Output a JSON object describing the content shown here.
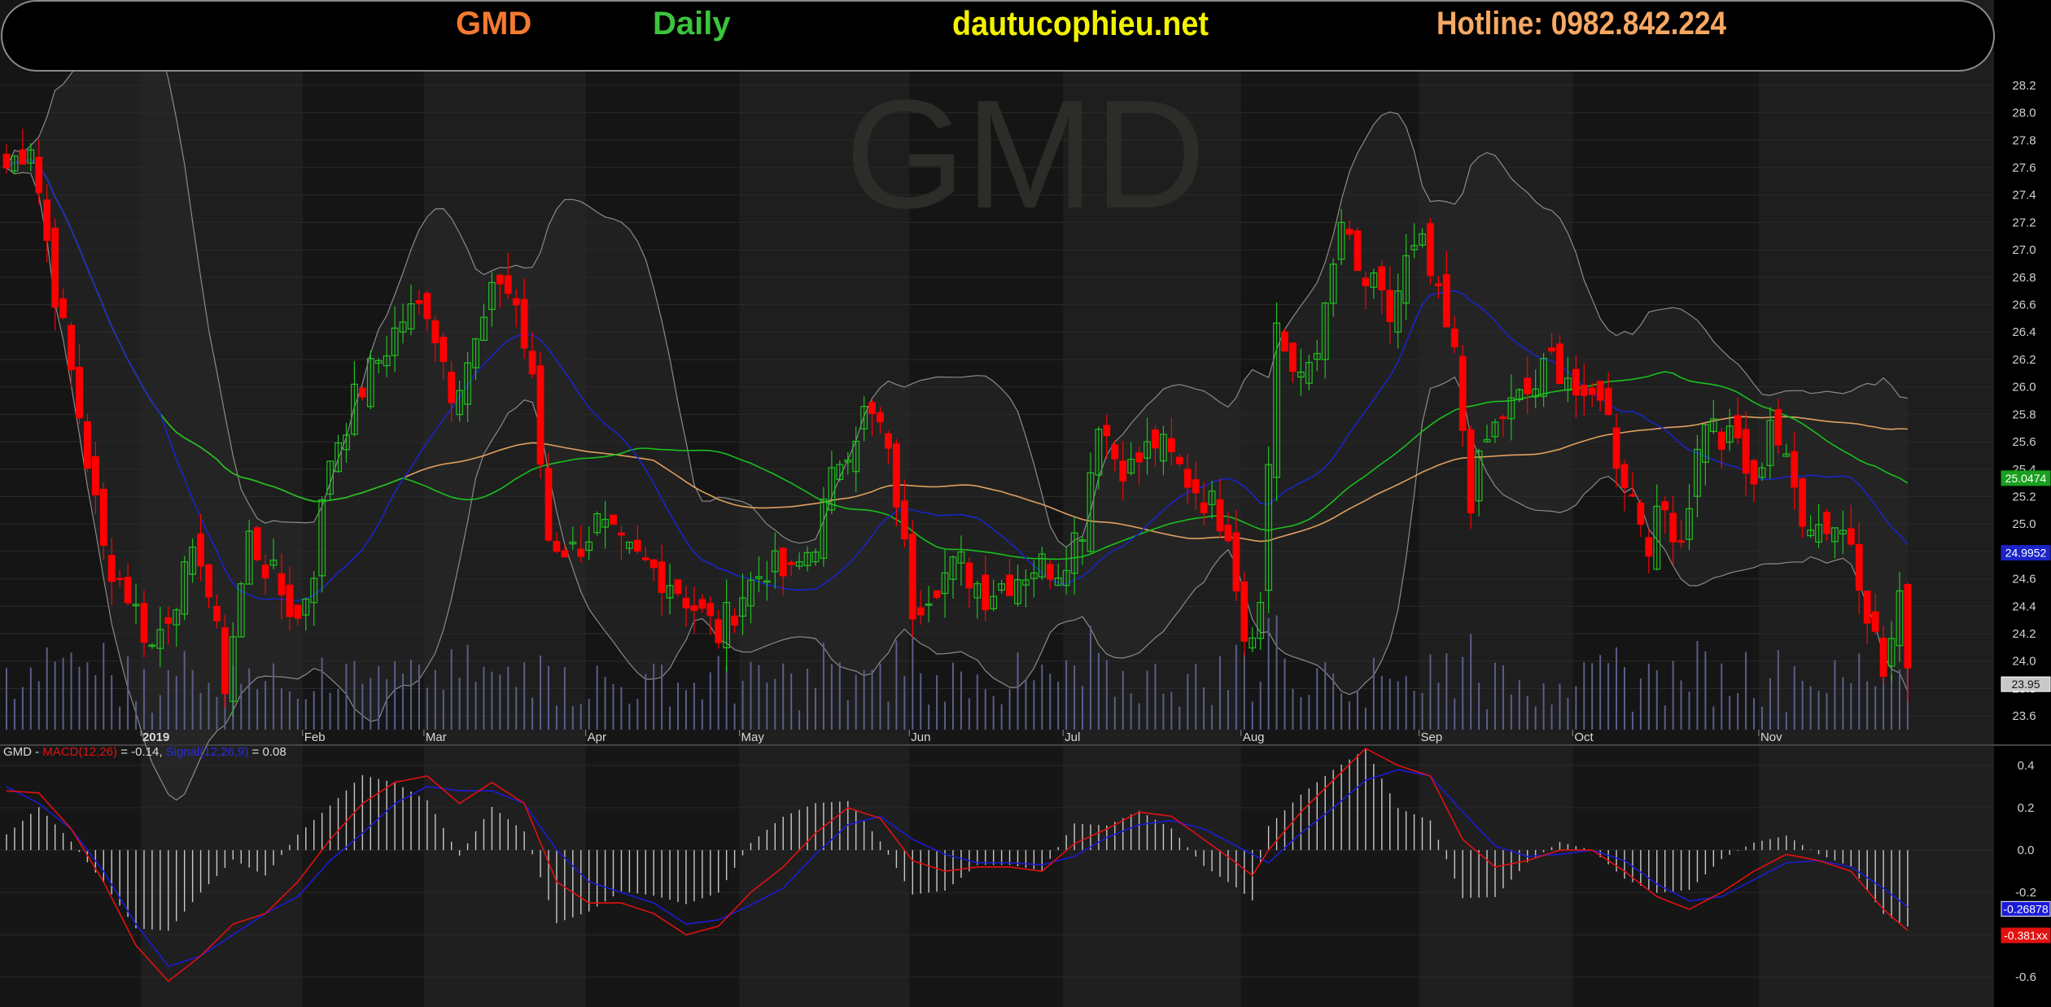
{
  "header": {
    "symbol": "GMD",
    "period": "Daily",
    "site": "dautucophieu.net",
    "hotline": "Hotline: 0982.842.224",
    "symbol_color": "#f47a30",
    "period_color": "#3cc43c",
    "site_color": "#f2f200",
    "hotline_color": "#f7a862"
  },
  "watermark": "GMD",
  "macd_legend": {
    "prefix": "GMD - ",
    "macd_label": "MACD(12,26)",
    "macd_value": " = -0.14, ",
    "signal_label": "Signal(12,26,9)",
    "signal_value": " = 0.08"
  },
  "chart_data": [
    {
      "type": "candlestick",
      "title": "GMD",
      "x_labels": [
        "2019",
        "Feb",
        "Mar",
        "Apr",
        "May",
        "Jun",
        "Jul",
        "Aug",
        "Sep",
        "Oct",
        "Nov"
      ],
      "x_label_bar_index": [
        17,
        37,
        52,
        72,
        91,
        112,
        131,
        153,
        175,
        194,
        217
      ],
      "y_ticks": [
        "28.2",
        "28.0",
        "27.8",
        "27.6",
        "27.4",
        "27.2",
        "27.0",
        "26.8",
        "26.6",
        "26.4",
        "26.2",
        "26.0",
        "25.8",
        "25.6",
        "25.4",
        "25.2",
        "25.0",
        "24.8",
        "24.6",
        "24.4",
        "24.2",
        "24.0",
        "23.8",
        "23.6"
      ],
      "ylim": [
        23.5,
        28.3
      ],
      "close_anchors": [
        [
          0,
          27.6
        ],
        [
          3,
          27.8
        ],
        [
          6,
          26.7
        ],
        [
          9,
          25.8
        ],
        [
          12,
          24.8
        ],
        [
          15,
          24.5
        ],
        [
          18,
          24.1
        ],
        [
          21,
          24.5
        ],
        [
          24,
          24.8
        ],
        [
          27,
          23.85
        ],
        [
          30,
          24.9
        ],
        [
          33,
          24.6
        ],
        [
          36,
          24.3
        ],
        [
          38,
          24.7
        ],
        [
          40,
          25.5
        ],
        [
          43,
          25.9
        ],
        [
          46,
          26.2
        ],
        [
          49,
          26.5
        ],
        [
          52,
          26.6
        ],
        [
          55,
          26.0
        ],
        [
          58,
          26.3
        ],
        [
          61,
          26.8
        ],
        [
          63,
          26.6
        ],
        [
          65,
          26.0
        ],
        [
          67,
          24.9
        ],
        [
          70,
          24.8
        ],
        [
          73,
          25.0
        ],
        [
          76,
          24.8
        ],
        [
          79,
          24.7
        ],
        [
          82,
          24.6
        ],
        [
          85,
          24.4
        ],
        [
          88,
          24.2
        ],
        [
          91,
          24.5
        ],
        [
          94,
          24.7
        ],
        [
          97,
          24.6
        ],
        [
          100,
          24.9
        ],
        [
          103,
          25.5
        ],
        [
          106,
          25.8
        ],
        [
          108,
          25.7
        ],
        [
          110,
          25.2
        ],
        [
          112,
          24.4
        ],
        [
          115,
          24.6
        ],
        [
          118,
          24.7
        ],
        [
          121,
          24.5
        ],
        [
          124,
          24.6
        ],
        [
          127,
          24.7
        ],
        [
          130,
          24.7
        ],
        [
          133,
          25.0
        ],
        [
          135,
          25.8
        ],
        [
          137,
          25.5
        ],
        [
          139,
          25.4
        ],
        [
          142,
          25.6
        ],
        [
          145,
          25.4
        ],
        [
          148,
          25.2
        ],
        [
          151,
          25.0
        ],
        [
          153,
          24.2
        ],
        [
          155,
          24.4
        ],
        [
          157,
          26.5
        ],
        [
          159,
          26.0
        ],
        [
          161,
          26.2
        ],
        [
          163,
          26.5
        ],
        [
          165,
          27.2
        ],
        [
          167,
          26.8
        ],
        [
          169,
          26.7
        ],
        [
          171,
          26.5
        ],
        [
          173,
          26.9
        ],
        [
          175,
          27.0
        ],
        [
          177,
          26.6
        ],
        [
          179,
          26.2
        ],
        [
          181,
          25.2
        ],
        [
          183,
          25.6
        ],
        [
          185,
          25.8
        ],
        [
          187,
          25.9
        ],
        [
          189,
          26.0
        ],
        [
          191,
          26.2
        ],
        [
          193,
          26.1
        ],
        [
          195,
          25.8
        ],
        [
          197,
          26.0
        ],
        [
          199,
          25.5
        ],
        [
          201,
          25.2
        ],
        [
          203,
          24.9
        ],
        [
          205,
          25.1
        ],
        [
          207,
          24.9
        ],
        [
          210,
          25.8
        ],
        [
          212,
          25.6
        ],
        [
          214,
          25.6
        ],
        [
          216,
          25.2
        ],
        [
          218,
          25.8
        ],
        [
          220,
          25.4
        ],
        [
          222,
          25.1
        ],
        [
          224,
          25.0
        ],
        [
          226,
          25.0
        ],
        [
          228,
          24.9
        ],
        [
          230,
          24.4
        ],
        [
          232,
          23.9
        ],
        [
          234,
          24.4
        ],
        [
          235,
          23.95
        ]
      ],
      "last_price": "23.95",
      "moving_averages": [
        {
          "name": "MA20",
          "color": "#1a24c8",
          "label": "24.9952"
        },
        {
          "name": "MA50",
          "color": "#19c01e",
          "label": "25.0474"
        },
        {
          "name": "MA200",
          "color": "#e0a060"
        }
      ],
      "bollinger_bands": {
        "color": "#8a8a8a"
      },
      "volume": {
        "color": "#5a5e8a"
      },
      "colors": {
        "up": "#20c020",
        "down": "#ff0000"
      }
    },
    {
      "type": "line",
      "title": "MACD",
      "y_ticks": [
        "0.4",
        "0.2",
        "0.0",
        "-0.2",
        "-0.4",
        "-0.6"
      ],
      "ylim": [
        -0.68,
        0.5
      ],
      "series": [
        {
          "name": "MACD(12,26)",
          "color": "#e21010",
          "value_label": "-0.381xx",
          "current": -0.14
        },
        {
          "name": "Signal(12,26,9)",
          "color": "#1b1bd8",
          "value_label": "-0.26878",
          "current": 0.08
        }
      ],
      "macd_anchors": [
        [
          0,
          0.28
        ],
        [
          4,
          0.27
        ],
        [
          8,
          0.1
        ],
        [
          12,
          -0.15
        ],
        [
          16,
          -0.45
        ],
        [
          20,
          -0.62
        ],
        [
          24,
          -0.5
        ],
        [
          28,
          -0.35
        ],
        [
          32,
          -0.3
        ],
        [
          36,
          -0.15
        ],
        [
          40,
          0.05
        ],
        [
          44,
          0.22
        ],
        [
          48,
          0.32
        ],
        [
          52,
          0.35
        ],
        [
          56,
          0.22
        ],
        [
          60,
          0.32
        ],
        [
          64,
          0.22
        ],
        [
          68,
          -0.15
        ],
        [
          72,
          -0.25
        ],
        [
          76,
          -0.25
        ],
        [
          80,
          -0.3
        ],
        [
          84,
          -0.4
        ],
        [
          88,
          -0.36
        ],
        [
          92,
          -0.2
        ],
        [
          96,
          -0.08
        ],
        [
          100,
          0.08
        ],
        [
          104,
          0.2
        ],
        [
          108,
          0.15
        ],
        [
          112,
          -0.05
        ],
        [
          116,
          -0.1
        ],
        [
          120,
          -0.08
        ],
        [
          124,
          -0.08
        ],
        [
          128,
          -0.1
        ],
        [
          132,
          0.03
        ],
        [
          136,
          0.1
        ],
        [
          140,
          0.18
        ],
        [
          144,
          0.16
        ],
        [
          148,
          0.05
        ],
        [
          152,
          -0.06
        ],
        [
          154,
          -0.12
        ],
        [
          156,
          0.0
        ],
        [
          160,
          0.18
        ],
        [
          164,
          0.33
        ],
        [
          168,
          0.48
        ],
        [
          172,
          0.4
        ],
        [
          176,
          0.35
        ],
        [
          180,
          0.05
        ],
        [
          184,
          -0.08
        ],
        [
          188,
          -0.05
        ],
        [
          192,
          0.0
        ],
        [
          196,
          0.0
        ],
        [
          200,
          -0.1
        ],
        [
          204,
          -0.22
        ],
        [
          208,
          -0.28
        ],
        [
          212,
          -0.2
        ],
        [
          216,
          -0.1
        ],
        [
          220,
          -0.02
        ],
        [
          224,
          -0.05
        ],
        [
          228,
          -0.1
        ],
        [
          232,
          -0.28
        ],
        [
          235,
          -0.38
        ]
      ],
      "signal_anchors": [
        [
          0,
          0.3
        ],
        [
          4,
          0.22
        ],
        [
          8,
          0.1
        ],
        [
          12,
          -0.1
        ],
        [
          16,
          -0.35
        ],
        [
          20,
          -0.55
        ],
        [
          24,
          -0.5
        ],
        [
          28,
          -0.4
        ],
        [
          32,
          -0.3
        ],
        [
          36,
          -0.22
        ],
        [
          40,
          -0.05
        ],
        [
          44,
          0.08
        ],
        [
          48,
          0.22
        ],
        [
          52,
          0.3
        ],
        [
          56,
          0.28
        ],
        [
          60,
          0.28
        ],
        [
          64,
          0.22
        ],
        [
          68,
          0.0
        ],
        [
          72,
          -0.15
        ],
        [
          76,
          -0.2
        ],
        [
          80,
          -0.25
        ],
        [
          84,
          -0.35
        ],
        [
          88,
          -0.33
        ],
        [
          92,
          -0.26
        ],
        [
          96,
          -0.18
        ],
        [
          100,
          -0.02
        ],
        [
          104,
          0.12
        ],
        [
          108,
          0.16
        ],
        [
          112,
          0.05
        ],
        [
          116,
          -0.02
        ],
        [
          120,
          -0.06
        ],
        [
          124,
          -0.06
        ],
        [
          128,
          -0.07
        ],
        [
          132,
          -0.03
        ],
        [
          136,
          0.06
        ],
        [
          140,
          0.12
        ],
        [
          144,
          0.14
        ],
        [
          148,
          0.1
        ],
        [
          152,
          0.02
        ],
        [
          156,
          -0.06
        ],
        [
          160,
          0.08
        ],
        [
          164,
          0.2
        ],
        [
          168,
          0.33
        ],
        [
          172,
          0.38
        ],
        [
          176,
          0.35
        ],
        [
          180,
          0.18
        ],
        [
          184,
          0.02
        ],
        [
          188,
          -0.03
        ],
        [
          192,
          -0.02
        ],
        [
          196,
          0.0
        ],
        [
          200,
          -0.05
        ],
        [
          204,
          -0.16
        ],
        [
          208,
          -0.24
        ],
        [
          212,
          -0.22
        ],
        [
          216,
          -0.14
        ],
        [
          220,
          -0.06
        ],
        [
          224,
          -0.05
        ],
        [
          228,
          -0.08
        ],
        [
          232,
          -0.18
        ],
        [
          235,
          -0.27
        ]
      ]
    }
  ]
}
